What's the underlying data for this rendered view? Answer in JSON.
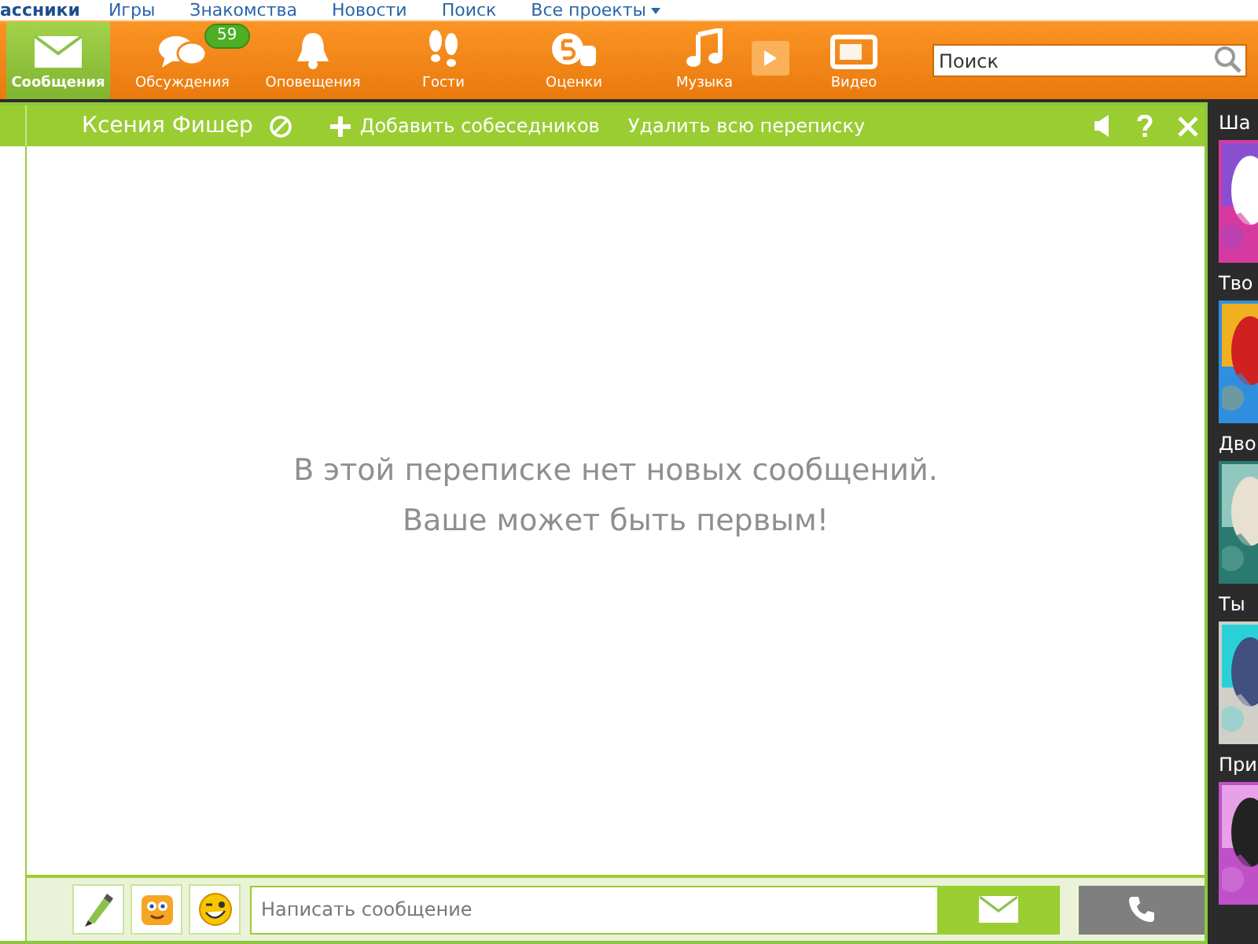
{
  "top_links": [
    {
      "label": "ассники",
      "kind": "logo"
    },
    {
      "label": "Игры",
      "kind": "link"
    },
    {
      "label": "Знакомства",
      "kind": "link"
    },
    {
      "label": "Новости",
      "kind": "link"
    },
    {
      "label": "Поиск",
      "kind": "link"
    },
    {
      "label": "Все проекты",
      "kind": "menu"
    }
  ],
  "nav": {
    "items": [
      {
        "label": "Сообщения",
        "selected": true
      },
      {
        "label": "Обсуждения",
        "selected": false,
        "badge": "59"
      },
      {
        "label": "Оповещения",
        "selected": false
      },
      {
        "label": "Гости",
        "selected": false
      },
      {
        "label": "Оценки",
        "selected": false
      },
      {
        "label": "Музыка",
        "selected": false
      },
      {
        "label": "Видео",
        "selected": false
      }
    ],
    "search": {
      "placeholder": "Поиск"
    }
  },
  "chat": {
    "contact": "Ксения Фишер",
    "actions": [
      "Добавить собеседников",
      "Удалить всю переписку"
    ],
    "empty_lines": [
      "В этой переписке нет новых сообщений.",
      "Ваше может быть первым!"
    ],
    "composer": {
      "placeholder": "Написать сообщение"
    }
  },
  "side_feed": [
    {
      "title": "Ша"
    },
    {
      "title": "Тво"
    },
    {
      "title": "Дво"
    },
    {
      "title": "Ты"
    },
    {
      "title": "При"
    }
  ]
}
